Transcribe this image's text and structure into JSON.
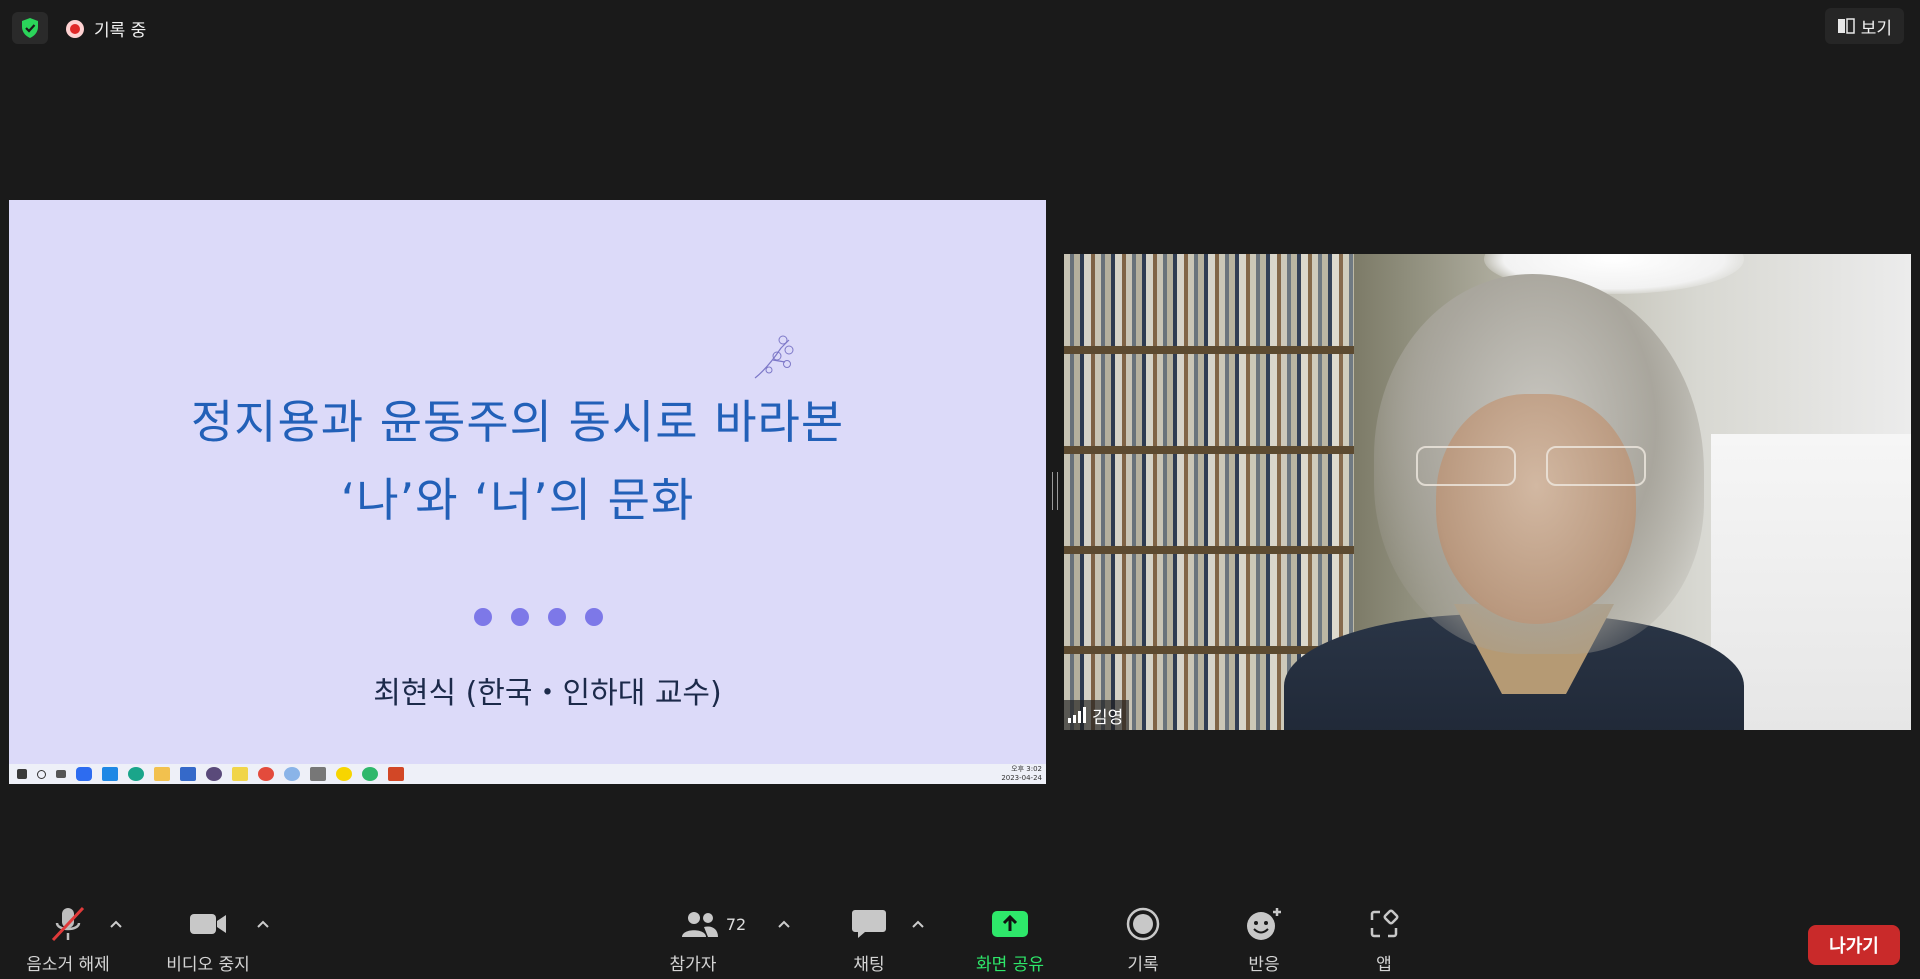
{
  "app": {
    "recording_label": "기록 중",
    "view_label": "보기"
  },
  "slide": {
    "title_line1": "정지용과 윤동주의 동시로 바라본",
    "title_line2": "‘나’와 ‘너’의 문화",
    "author": "최현식 (한국・인하대 교수)",
    "taskbar_time": "오후 3:02",
    "taskbar_date": "2023-04-24"
  },
  "participant": {
    "name": "김영"
  },
  "toolbar": {
    "unmute_label": "음소거 해제",
    "stop_video_label": "비디오 중지",
    "participants_label": "참가자",
    "participants_count": "72",
    "chat_label": "채팅",
    "share_label": "화면 공유",
    "record_label": "기록",
    "reactions_label": "반응",
    "apps_label": "앱",
    "leave_label": "나가기"
  },
  "colors": {
    "share_green": "#2ee76a",
    "leave_red": "#c92a2a",
    "slide_bg": "#dcdaf9",
    "slide_title": "#2260b8"
  }
}
